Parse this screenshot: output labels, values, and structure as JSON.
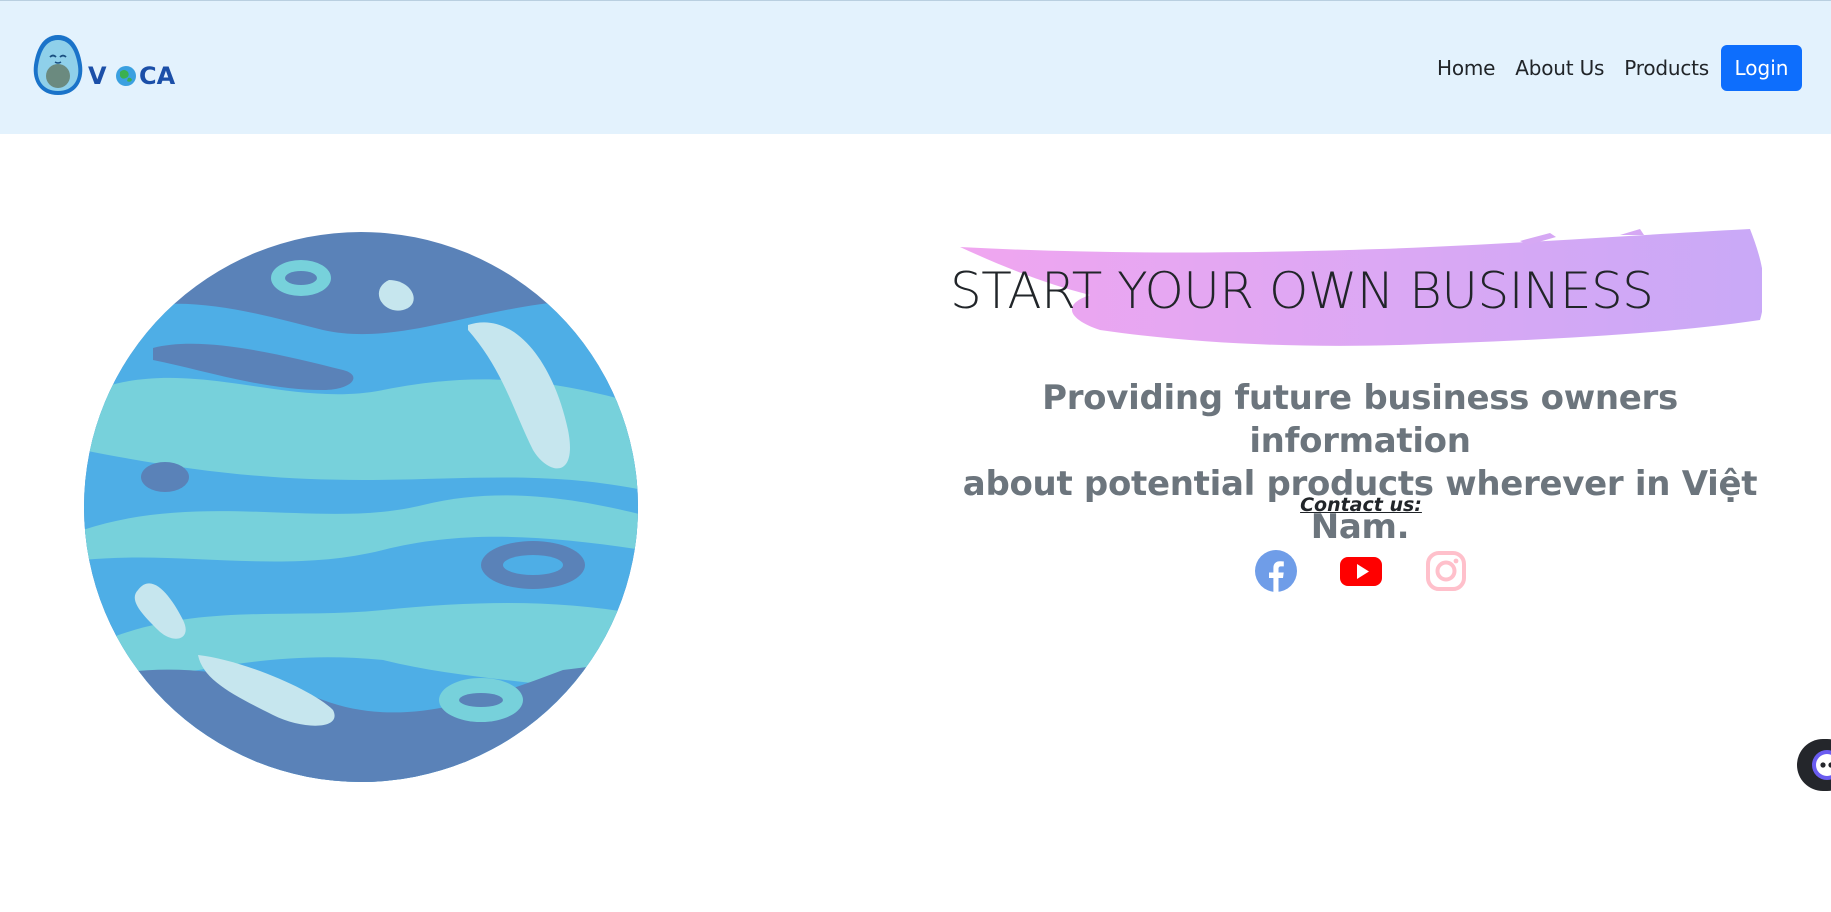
{
  "brand": {
    "name": "VOCA",
    "logo_icon": "avocado-logo-icon"
  },
  "nav": {
    "links": [
      {
        "label": "Home"
      },
      {
        "label": "About Us"
      },
      {
        "label": "Products"
      }
    ],
    "login_label": "Login"
  },
  "hero": {
    "heading": "START YOUR OWN BUSINESS",
    "subtext_line1": "Providing future business owners information",
    "subtext_line2": "about potential products wherever in Việt Nam.",
    "contact_label": "Contact us:",
    "image_icon": "planet-illustration"
  },
  "social": [
    {
      "name": "Facebook",
      "icon": "facebook-icon",
      "color": "#1877f2"
    },
    {
      "name": "YouTube",
      "icon": "youtube-icon",
      "color": "#ff0000"
    },
    {
      "name": "Instagram",
      "icon": "instagram-icon",
      "color": "#ffc0cb"
    }
  ],
  "colors": {
    "navbar_bg": "#e3f2fd",
    "login_bg": "#0d6efd",
    "brush_gradient": [
      "#f0a6f0",
      "#c9a9f7"
    ],
    "subtext": "#6c757d"
  },
  "chat_widget_icon": "chat-bot-icon"
}
